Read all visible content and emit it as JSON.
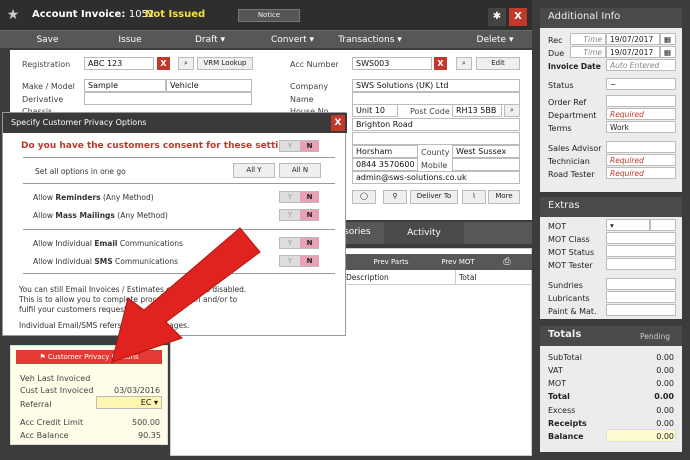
{
  "window": {
    "title": "Account Invoice:",
    "number": "1052",
    "status": "Not Issued",
    "notice": "Notice",
    "close": "X"
  },
  "actions": [
    {
      "label": "Save"
    },
    {
      "label": "Issue"
    },
    {
      "label": "Draft ▾"
    },
    {
      "label": "Convert ▾"
    },
    {
      "label": "Transactions ▾"
    },
    {
      "label": "Delete ▾"
    }
  ],
  "vehicle": {
    "registration_label": "Registration",
    "registration": "ABC 123",
    "vrm_lookup": "VRM Lookup",
    "make_label": "Make / Model",
    "make": "Sample",
    "model": "Vehicle",
    "derivative_label": "Derivative",
    "chassis_label": "Chassis"
  },
  "customer": {
    "acc_number_label": "Acc Number",
    "acc_number": "SWS003",
    "edit": "Edit",
    "company_label": "Company",
    "company": "SWS Solutions (UK) Ltd",
    "name_label": "Name",
    "house_label": "House No",
    "house": "Unit 10",
    "postcode_label": "Post Code",
    "postcode": "RH13 5BB",
    "street": "Brighton Road",
    "town": "Horsham",
    "county_label": "County",
    "county": "West Sussex",
    "phone": "0844 3570600",
    "mobile_label": "Mobile",
    "email": "admin@sws-solutions.co.uk",
    "deliver_to": "Deliver To",
    "more": "More"
  },
  "tabs": [
    {
      "label": "sories"
    },
    {
      "label": "Activity"
    }
  ],
  "subbar": {
    "prev_parts": "Prev Parts",
    "prev_mot": "Prev MOT",
    "description": "Description",
    "total": "Total"
  },
  "leftcard": {
    "cpo": "Customer Privacy Options",
    "veh_last_invoiced": "Veh Last Invoiced",
    "cust_last_invoiced_label": "Cust Last Invoiced",
    "cust_last_invoiced": "03/03/2016",
    "referral_label": "Referral",
    "referral": "EC ▾",
    "acc_credit_limit_label": "Acc Credit Limit",
    "acc_credit_limit": "500.00",
    "acc_balance_label": "Acc Balance",
    "acc_balance": "90.35"
  },
  "modal": {
    "title": "Specify Customer Privacy Options",
    "question": "Do you have the customers consent for these settings?",
    "set_all": "Set all options in one go",
    "all_y": "All Y",
    "all_n": "All N",
    "yes": "Y",
    "no": "N",
    "reminders_pre": "Allow ",
    "reminders_bold": "Reminders",
    "reminders_post": " (Any Method)",
    "mass_pre": "Allow ",
    "mass_bold": "Mass Mailings",
    "mass_post": " (Any Method)",
    "email_pre": "Allow Individual ",
    "email_bold": "Email",
    "email_post": " Communications",
    "sms_pre": "Allow Individual ",
    "sms_bold": "SMS",
    "sms_post": " Communications",
    "info1": "You can still Email Invoices / Estimates eve",
    "info1b": "options disabled.",
    "info2": "This is to allow you to complete processi",
    "info2b": "saction and/or to",
    "info3": "fulfil your customers requests.",
    "info4": "Individual Email/SMS refers to sen",
    "info4b": "messages."
  },
  "additional": {
    "title": "Additional Info",
    "rec_label": "Rec",
    "rec_time": "Time",
    "rec_date": "19/07/2017",
    "due_label": "Due",
    "due_time": "Time",
    "due_date": "19/07/2017",
    "invoice_date_label": "Invoice Date",
    "invoice_date": "Auto Entered",
    "status_label": "Status",
    "status": "~",
    "order_ref_label": "Order Ref",
    "department_label": "Department",
    "department": "Required",
    "terms_label": "Terms",
    "terms": "Work",
    "sales_advisor_label": "Sales Advisor",
    "technician_label": "Technician",
    "technician": "Required",
    "road_tester_label": "Road Tester",
    "road_tester": "Required"
  },
  "extras": {
    "title": "Extras",
    "items": [
      {
        "label": "MOT"
      },
      {
        "label": "MOT Class"
      },
      {
        "label": "MOT Status"
      },
      {
        "label": "MOT Tester"
      },
      {
        "label": "Sundries"
      },
      {
        "label": "Lubricants"
      },
      {
        "label": "Paint & Mat."
      }
    ]
  },
  "totals": {
    "title": "Totals",
    "status": "Pending",
    "rows": [
      {
        "label": "SubTotal",
        "value": "0.00"
      },
      {
        "label": "VAT",
        "value": "0.00"
      },
      {
        "label": "MOT",
        "value": "0.00"
      },
      {
        "label": "Total",
        "value": "0.00"
      },
      {
        "label": "Excess",
        "value": "0.00"
      },
      {
        "label": "Receipts",
        "value": "0.00"
      },
      {
        "label": "Balance",
        "value": "0.00"
      }
    ]
  },
  "colors": {
    "accent_red": "#c0392b",
    "arrow_red": "#e0231f",
    "status_yellow": "#f5e33b"
  }
}
